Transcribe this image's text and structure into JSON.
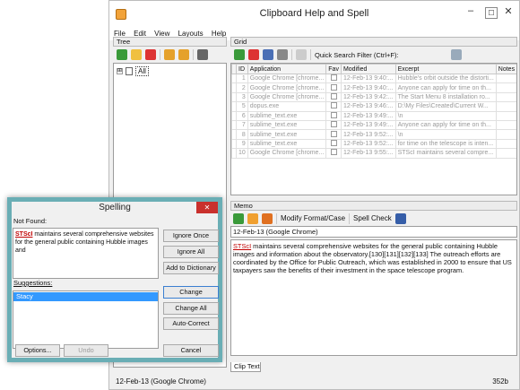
{
  "window": {
    "title": "Clipboard Help and Spell",
    "controls": [
      "–",
      "☐",
      "✕"
    ]
  },
  "menu": [
    "File",
    "Edit",
    "View",
    "Layouts",
    "Help"
  ],
  "tree": {
    "title": "Tree",
    "root_label": "All",
    "expander": "⊞"
  },
  "grid": {
    "title": "Grid",
    "quick_search_label": "Quick Search Filter (Ctrl+F):",
    "columns": [
      "ID",
      "Application",
      "Fav",
      "Modified",
      "Excerpt",
      "Notes"
    ],
    "rows": [
      {
        "id": "1",
        "app": "Google Chrome [chrome...",
        "mod": "12-Feb-13 9:40:...",
        "excerpt": "Hubble's orbit outside the distorti..."
      },
      {
        "id": "2",
        "app": "Google Chrome [chrome...",
        "mod": "12-Feb-13 9:40:...",
        "excerpt": "Anyone can apply for time on th..."
      },
      {
        "id": "3",
        "app": "Google Chrome [chrome...",
        "mod": "12-Feb-13 9:42:...",
        "excerpt": "The Start Menu 8 installation ro..."
      },
      {
        "id": "5",
        "app": "dopus.exe",
        "mod": "12-Feb-13 9:46:...",
        "excerpt": "D:\\My Files\\Created\\Current W..."
      },
      {
        "id": "6",
        "app": "sublime_text.exe",
        "mod": "12-Feb-13 9:49:...",
        "excerpt": "\\n"
      },
      {
        "id": "7",
        "app": "sublime_text.exe",
        "mod": "12-Feb-13 9:49:...",
        "excerpt": "Anyone can apply for time on th..."
      },
      {
        "id": "8",
        "app": "sublime_text.exe",
        "mod": "12-Feb-13 9:52:...",
        "excerpt": "\\n"
      },
      {
        "id": "9",
        "app": "sublime_text.exe",
        "mod": "12-Feb-13 9:52:...",
        "excerpt": "for time on the telescope is inten..."
      },
      {
        "id": "10",
        "app": "Google Chrome [chrome...",
        "mod": "12-Feb-13 9:55:...",
        "excerpt": "STScI maintains several compre..."
      }
    ]
  },
  "memo": {
    "title": "Memo",
    "modify_label": "Modify Format/Case",
    "spell_label": "Spell Check",
    "source": "12-Feb-13 (Google Chrome)",
    "text_word": "STScI",
    "text_rest": " maintains several comprehensive websites for the general public containing Hubble images and information about the observatory.[130][131][132][133] The outreach efforts are coordinated by the Office for Public Outreach, which was established in 2000 to ensure that US taxpayers saw the benefits of their investment in the space telescope program.",
    "tab": "Clip Text"
  },
  "status": {
    "left": "12-Feb-13 (Google Chrome)",
    "right": "352b"
  },
  "spelling": {
    "title": "Spelling",
    "not_found_label": "Not Found:",
    "not_found_word": "STScI",
    "not_found_rest": " maintains several comprehensive websites for the general public containing Hubble images and",
    "suggestions_label": "Suggestions:",
    "suggestion": "Stacy",
    "buttons": {
      "ignore_once": "Ignore Once",
      "ignore_all": "Ignore All",
      "add_dict": "Add to Dictionary",
      "change": "Change",
      "change_all": "Change All",
      "auto_correct": "Auto-Correct",
      "options": "Options...",
      "undo": "Undo",
      "cancel": "Cancel"
    }
  }
}
